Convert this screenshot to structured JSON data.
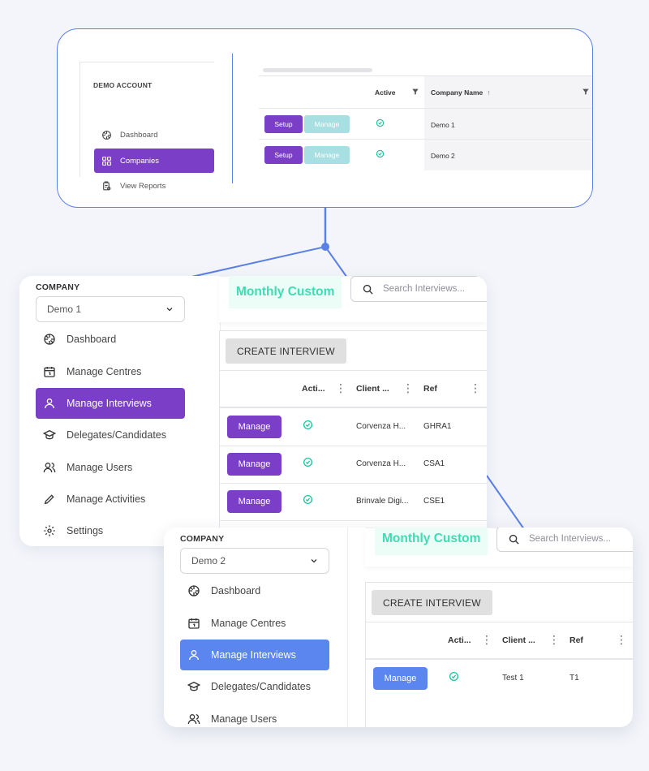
{
  "colors": {
    "purple": "#7a3fc6",
    "blue": "#5b86f0",
    "teal_light": "#a8dfe2",
    "mint": "#3fdcb4",
    "connector": "#5b80e6"
  },
  "top_card": {
    "sidebar_heading": "DEMO ACCOUNT",
    "nav": [
      {
        "label": "Dashboard",
        "icon": "dashboard-icon",
        "active": false
      },
      {
        "label": "Companies",
        "icon": "grid-icon",
        "active": true
      },
      {
        "label": "View Reports",
        "icon": "report-icon",
        "active": false
      }
    ],
    "table": {
      "headers": {
        "active": "Active",
        "company_name": "Company Name",
        "sort": "↑"
      },
      "rows": [
        {
          "setup": "Setup",
          "manage": "Manage",
          "company": "Demo 1"
        },
        {
          "setup": "Setup",
          "manage": "Manage",
          "company": "Demo 2"
        }
      ]
    }
  },
  "screen1": {
    "company_label": "COMPANY",
    "company_value": "Demo 1",
    "logo": "Monthly Custom",
    "search_placeholder": "Search Interviews...",
    "nav": [
      {
        "label": "Dashboard",
        "icon": "dashboard-icon"
      },
      {
        "label": "Manage Centres",
        "icon": "calendar-icon"
      },
      {
        "label": "Manage Interviews",
        "icon": "user-icon"
      },
      {
        "label": "Delegates/Candidates",
        "icon": "graduation-cap-icon"
      },
      {
        "label": "Manage Users",
        "icon": "users-icon"
      },
      {
        "label": "Manage Activities",
        "icon": "pencil-icon"
      },
      {
        "label": "Settings",
        "icon": "gear-icon"
      }
    ],
    "create_button": "CREATE INTERVIEW",
    "headers": {
      "active": "Acti...",
      "client": "Client ...",
      "ref": "Ref"
    },
    "rows": [
      {
        "button": "Manage",
        "client": "Corvenza H...",
        "ref": "GHRA1"
      },
      {
        "button": "Manage",
        "client": "Corvenza H...",
        "ref": "CSA1"
      },
      {
        "button": "Manage",
        "client": "Brinvale Digi...",
        "ref": "CSE1"
      }
    ]
  },
  "screen2": {
    "company_label": "COMPANY",
    "company_value": "Demo 2",
    "logo": "Monthly Custom",
    "search_placeholder": "Search Interviews...",
    "nav": [
      {
        "label": "Dashboard",
        "icon": "dashboard-icon"
      },
      {
        "label": "Manage Centres",
        "icon": "calendar-icon"
      },
      {
        "label": "Manage Interviews",
        "icon": "user-icon"
      },
      {
        "label": "Delegates/Candidates",
        "icon": "graduation-cap-icon"
      },
      {
        "label": "Manage Users",
        "icon": "users-icon"
      }
    ],
    "create_button": "CREATE INTERVIEW",
    "headers": {
      "active": "Acti...",
      "client": "Client ...",
      "ref": "Ref"
    },
    "rows": [
      {
        "button": "Manage",
        "client": "Test 1",
        "ref": "T1"
      }
    ]
  }
}
